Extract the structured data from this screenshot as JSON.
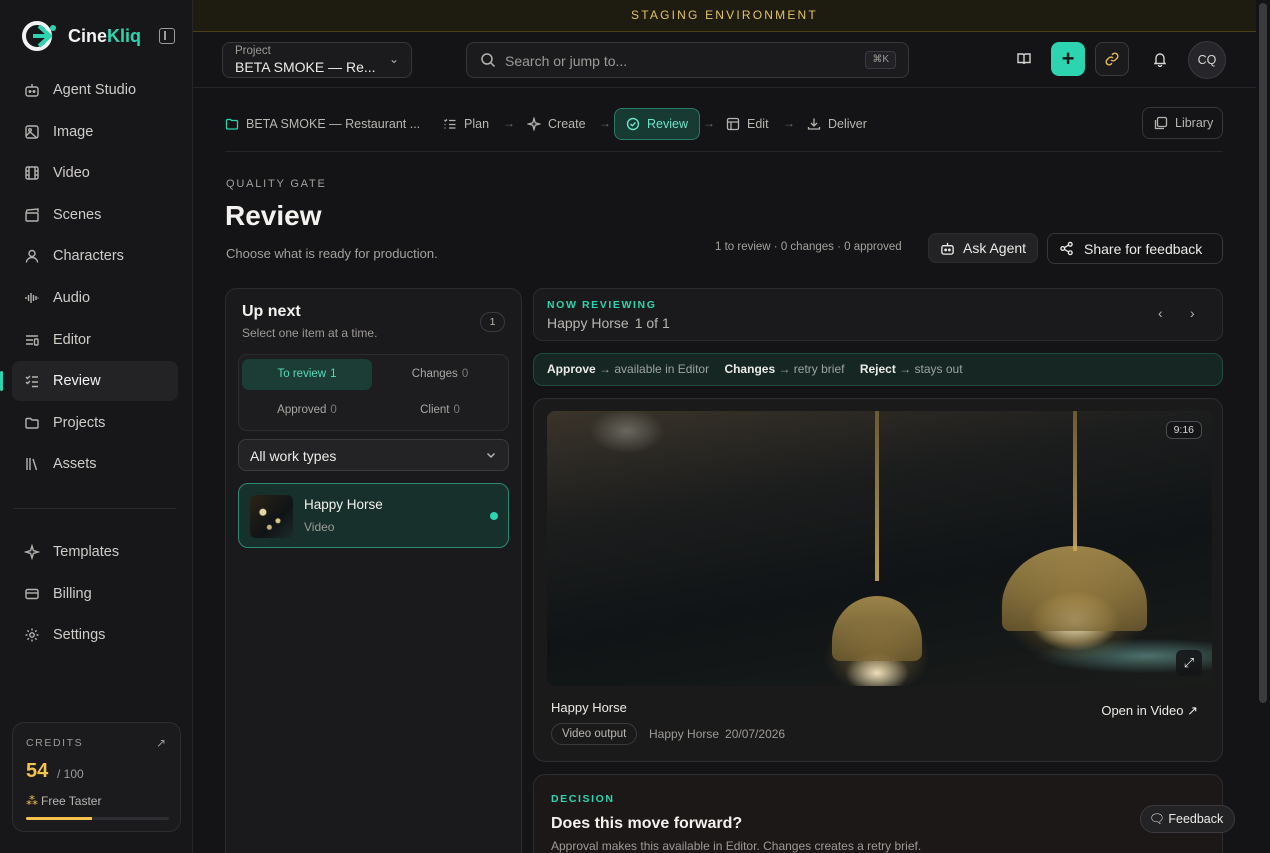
{
  "brand": {
    "name_part1": "Cine",
    "name_part2": "Kliq"
  },
  "banner": {
    "text": "STAGING ENVIRONMENT"
  },
  "sidebar": {
    "items": [
      {
        "label": "Agent Studio",
        "icon": "robot-icon"
      },
      {
        "label": "Image",
        "icon": "image-icon"
      },
      {
        "label": "Video",
        "icon": "film-icon"
      },
      {
        "label": "Scenes",
        "icon": "clapperboard-icon"
      },
      {
        "label": "Characters",
        "icon": "user-icon"
      },
      {
        "label": "Audio",
        "icon": "waveform-icon"
      },
      {
        "label": "Editor",
        "icon": "editor-icon"
      },
      {
        "label": "Review",
        "icon": "checklist-icon",
        "active": true
      },
      {
        "label": "Projects",
        "icon": "folder-icon"
      },
      {
        "label": "Assets",
        "icon": "library-icon"
      }
    ],
    "secondary": [
      {
        "label": "Templates",
        "icon": "sparkle-icon"
      },
      {
        "label": "Billing",
        "icon": "credit-card-icon"
      },
      {
        "label": "Settings",
        "icon": "gear-icon"
      }
    ],
    "credits": {
      "title": "CREDITS",
      "value": "54",
      "total": "/ 100",
      "plan": "Free Taster",
      "used_fraction": 0.46
    }
  },
  "header": {
    "project_label": "Project",
    "project_value": "BETA SMOKE — Re...",
    "search_placeholder": "Search or jump to...",
    "search_shortcut": "⌘K",
    "avatar_initials": "CQ",
    "accent": "#2dd4b0"
  },
  "stepper": {
    "project": "BETA SMOKE — Restaurant ...",
    "steps": [
      "Plan",
      "Create",
      "Review",
      "Edit",
      "Deliver"
    ],
    "active": "Review",
    "library": "Library"
  },
  "page": {
    "eyebrow": "QUALITY GATE",
    "title": "Review",
    "subtitle": "Choose what is ready for production.",
    "stats": "1 to review · 0 changes · 0 approved",
    "ask_agent": "Ask Agent",
    "share": "Share for feedback"
  },
  "upnext": {
    "title": "Up next",
    "subtitle": "Select one item at a time.",
    "count": "1",
    "filters": [
      {
        "label": "To review",
        "count": "1"
      },
      {
        "label": "Changes",
        "count": "0"
      },
      {
        "label": "Approved",
        "count": "0"
      },
      {
        "label": "Client",
        "count": "0"
      }
    ],
    "worktype": "All work types",
    "item": {
      "name": "Happy Horse",
      "type": "Video"
    }
  },
  "now": {
    "eyebrow": "NOW REVIEWING",
    "title": "Happy Horse",
    "position": "1 of 1"
  },
  "hint": {
    "approve_label": "Approve",
    "approve_text": "→ available in Editor",
    "changes_label": "Changes",
    "changes_text": "→ retry brief",
    "reject_label": "Reject",
    "reject_text": "→ stays out"
  },
  "media": {
    "aspect": "9:16",
    "title": "Happy Horse",
    "open": "Open in Video ↗",
    "chip": "Video output",
    "meta_name": "Happy Horse",
    "meta_date": "20/07/2026"
  },
  "decision": {
    "eyebrow": "DECISION",
    "title": "Does this move forward?",
    "subtitle": "Approval makes this available in Editor. Changes creates a retry brief."
  },
  "feedback": {
    "label": "Feedback"
  }
}
